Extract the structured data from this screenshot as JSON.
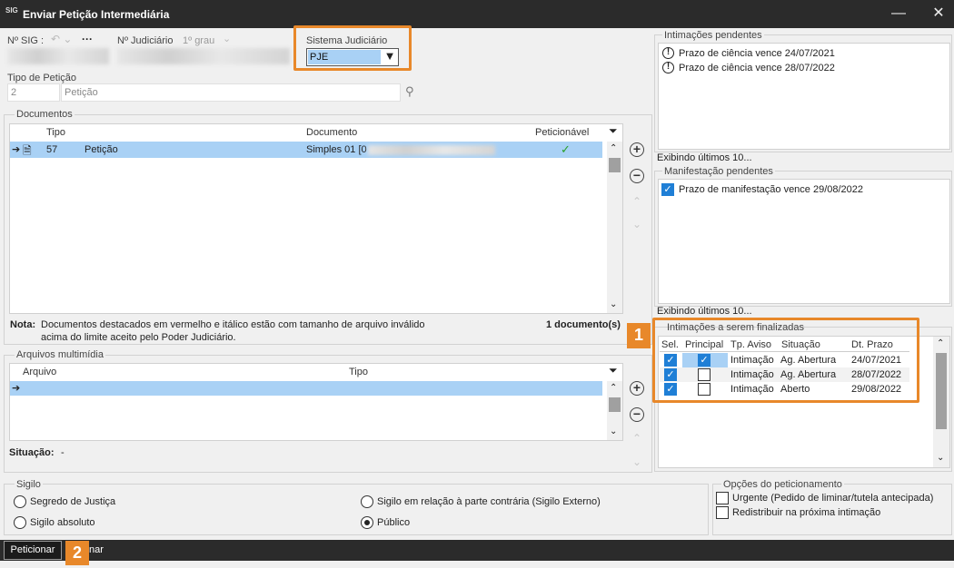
{
  "window": {
    "title": "Enviar Petição Intermediária",
    "app_icon_text": "SIG",
    "minimize_glyph": "—",
    "close_glyph": "✕"
  },
  "header": {
    "sig_label": "Nº SIG :",
    "more_glyph": "···",
    "judicial_label": "Nº Judiciário",
    "grade_label": "1º grau",
    "system_label": "Sistema Judiciário",
    "system_value": "PJE"
  },
  "petition_type": {
    "label": "Tipo de Petição",
    "code": "2",
    "name": "Petição"
  },
  "documents": {
    "group_title": "Documentos",
    "columns": [
      "Tipo",
      "Documento",
      "Peticionável"
    ],
    "rows": [
      {
        "code": "57",
        "type": "Petição",
        "document": "Simples 01 [0"
      }
    ],
    "note_label": "Nota:",
    "note_text": "Documentos destacados em vermelho e itálico estão com tamanho de arquivo inválido",
    "note_text2": "acima do limite aceito pelo Poder Judiciário.",
    "count": "1 documento(s)"
  },
  "media": {
    "group_title": "Arquivos multimídia",
    "columns": [
      "Arquivo",
      "Tipo"
    ],
    "status_label": "Situação:",
    "status_value": "-"
  },
  "pending_notices": {
    "title": "Intimações pendentes",
    "items": [
      "Prazo de ciência vence 24/07/2021",
      "Prazo de ciência vence 28/07/2022"
    ],
    "footer": "Exibindo últimos 10..."
  },
  "pending_manifest": {
    "title": "Manifestação pendentes",
    "items": [
      "Prazo de manifestação vence 29/08/2022"
    ],
    "footer": "Exibindo últimos 10..."
  },
  "to_finalize": {
    "title": "Intimações a serem finalizadas",
    "columns": [
      "Sel.",
      "Principal",
      "Tp. Aviso",
      "Situação",
      "Dt. Prazo"
    ],
    "rows": [
      {
        "tipo": "Intimação",
        "situacao": "Ag. Abertura",
        "prazo": "24/07/2021",
        "principal": true
      },
      {
        "tipo": "Intimação",
        "situacao": "Ag. Abertura",
        "prazo": "28/07/2022",
        "principal": false
      },
      {
        "tipo": "Intimação",
        "situacao": "Aberto",
        "prazo": "29/08/2022",
        "principal": false
      }
    ]
  },
  "secrecy": {
    "title": "Sigilo",
    "options": [
      "Segredo de Justiça",
      "Sigilo absoluto",
      "Sigilo em relação à parte contrária (Sigilo Externo)",
      "Público"
    ],
    "selected": "Público"
  },
  "petition_options": {
    "title": "Opções do peticionamento",
    "urgent": "Urgente (Pedido de liminar/tutela antecipada)",
    "redistribute": "Redistribuir na próxima intimação"
  },
  "footer": {
    "submit_label": "Peticionar",
    "cancel_label": "nar"
  },
  "badges": [
    "1",
    "2"
  ],
  "colors": {
    "accent": "#e8882a",
    "selection": "#a9d1f5",
    "check": "#1f7fd6",
    "titlebar": "#2b2b2b"
  }
}
